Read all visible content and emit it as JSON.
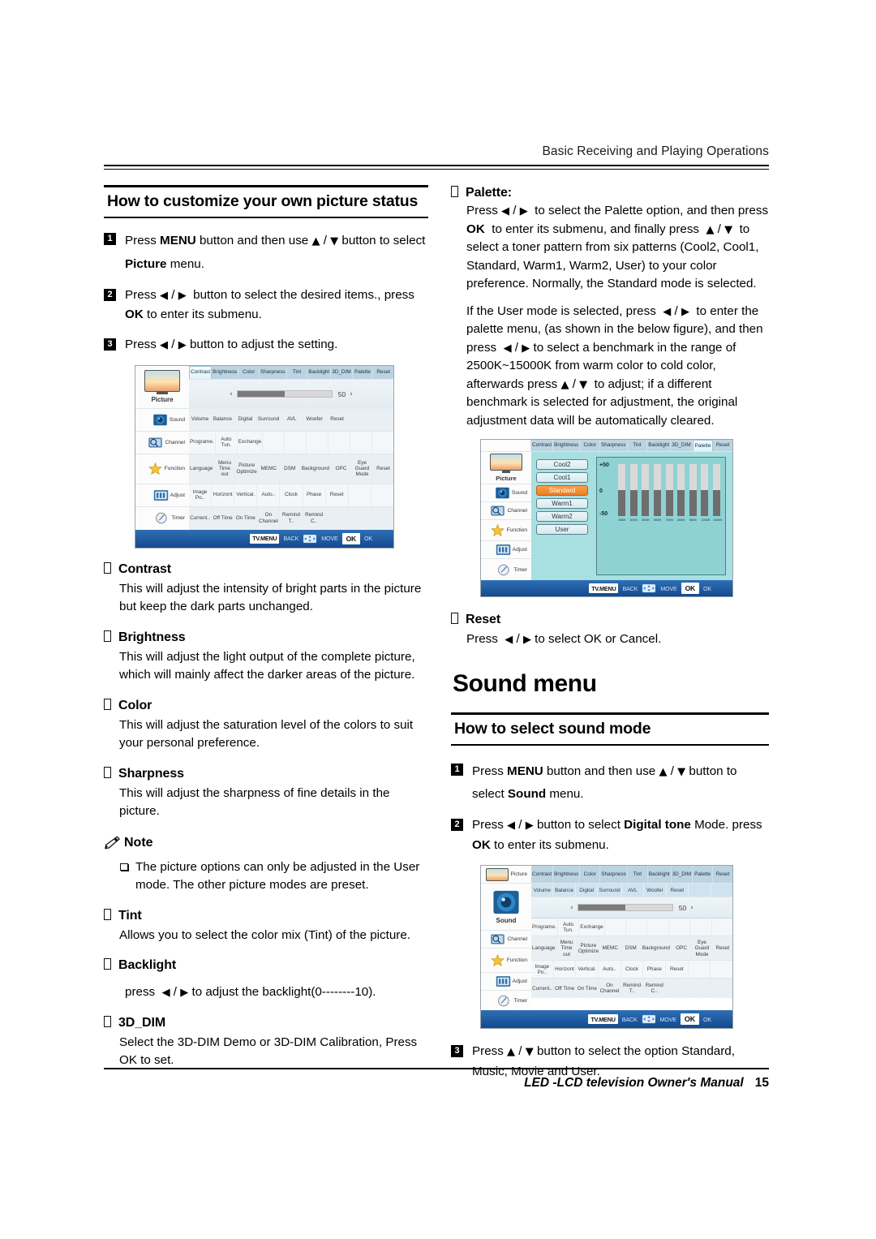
{
  "header": {
    "running_head": "Basic Receiving and Playing Operations"
  },
  "footer": {
    "manual_title": "LED -LCD television Owner's Manual",
    "page_number": "15"
  },
  "left_column": {
    "section_title": "How to customize your own picture status",
    "steps": [
      {
        "num": "1",
        "html": "Press <b>MENU</b> button and then use <span class=\"ar\">▲</span> / <span class=\"ar\">▼</span> button to select <b>Picture</b> menu."
      },
      {
        "num": "2",
        "html": "Press <span class=\"ar\">◀</span> / <span class=\"ar\">▶</span>&nbsp; button to select the desired items., press <b>OK</b> to enter its submenu."
      },
      {
        "num": "3",
        "html": "Press <span class=\"ar\">◀</span> / <span class=\"ar\">▶</span> button to adjust the setting."
      }
    ],
    "items": [
      {
        "title": "Contrast",
        "body": "This will adjust the intensity of bright parts in the picture but keep the dark parts unchanged."
      },
      {
        "title": "Brightness",
        "body": "This will adjust the light output of the complete picture, which will mainly affect the darker areas of the picture."
      },
      {
        "title": "Color",
        "body": "This will adjust the saturation level of the colors to suit your personal preference."
      },
      {
        "title": "Sharpness",
        "body": "This will adjust the sharpness of fine details in the picture."
      }
    ],
    "note": {
      "title": "Note",
      "text": "The picture options can only be adjusted in the User mode. The other picture modes are preset."
    },
    "items2": [
      {
        "title": "Tint",
        "body": "Allows you to select the color mix (Tint) of the picture."
      }
    ],
    "backlight": {
      "title": "Backlight",
      "body_html": "press&nbsp; <span class=\"ar\">◀</span> / <span class=\"ar\">▶</span> to adjust the backlight(0--------10)."
    },
    "dim": {
      "title": "3D_DIM",
      "body": "Select the 3D-DIM Demo or 3D-DIM Calibration, Press OK to set."
    }
  },
  "right_column": {
    "palette": {
      "title": "Palette:",
      "paragraph1_html": "Press <span class=\"ar\">◀</span> / <span class=\"ar\">▶</span>&nbsp; to select the Palette option, and then press <b>OK</b>&nbsp; to enter its submenu, and finally press&nbsp; <span class=\"ar\">▲</span> / <span class=\"ar\">▼</span>&nbsp; to select a toner pattern from six patterns (Cool2, Cool1, Standard, Warm1, Warm2, User) to your color preference. Normally, the Standard mode is selected.",
      "paragraph2_html": "If the User mode is selected, press&nbsp; <span class=\"ar\">◀</span> / <span class=\"ar\">▶</span>&nbsp; to enter the palette menu, (as shown in the below figure), and then press&nbsp; <span class=\"ar\">◀</span> / <span class=\"ar\">▶</span> to select a benchmark in the range of 2500K~15000K from warm color to cold color, afterwards press <span class=\"ar\">▲</span> / <span class=\"ar\">▼</span>&nbsp; to adjust; if a different benchmark is selected for adjustment, the original adjustment data will be automatically cleared."
    },
    "reset": {
      "title": "Reset",
      "body_html": "Press&nbsp; <span class=\"ar\">◀</span> / <span class=\"ar\">▶</span> to select OK or Cancel."
    },
    "chapter_title": "Sound menu",
    "section_title": "How to select sound mode",
    "steps": [
      {
        "num": "1",
        "html": "Press <b>MENU</b> button and then use <span class=\"ar\">▲</span> / <span class=\"ar\">▼</span> button to select <b>Sound</b> menu."
      },
      {
        "num": "2",
        "html": "Press <span class=\"ar\">◀</span> / <span class=\"ar\">▶</span> button to select <b>Digital tone</b> Mode. press <b>OK</b> to enter its submenu."
      },
      {
        "num": "3",
        "html": "Press <span class=\"ar\">▲</span> / <span class=\"ar\">▼</span> button to select the option Standard, Music, Movie and User."
      }
    ]
  },
  "osd": {
    "sidebar": [
      {
        "label": "Picture",
        "icon": "tv-icon"
      },
      {
        "label": "Sound",
        "icon": "speaker-icon"
      },
      {
        "label": "Channel",
        "icon": "channel-icon"
      },
      {
        "label": "Function",
        "icon": "star-icon"
      },
      {
        "label": "Adjust",
        "icon": "adjust-icon"
      },
      {
        "label": "Timer",
        "icon": "clock-icon"
      }
    ],
    "picture_row": [
      "Contrast",
      "Brightness",
      "Color",
      "Sharpness",
      "Tint",
      "Backlight",
      "3D_DIM",
      "Palette",
      "Reset"
    ],
    "sound_row": [
      "Volume",
      "Balance",
      "Digital",
      "Surround",
      "AVL",
      "Woofer",
      "Reset",
      "",
      ""
    ],
    "channel_row": [
      "Programe.",
      "Auto Tun.",
      "Exchange",
      "",
      "",
      "",
      "",
      "",
      ""
    ],
    "function_row": [
      "Language",
      "Menu Time out",
      "Picture Optimize",
      "MEMC",
      "DSM",
      "Background",
      "OPC",
      "Eye Guard Mode",
      "Reset"
    ],
    "adjust_row": [
      "Image Po..",
      "Horizont",
      "Vertical.",
      "Auto..",
      "Clock",
      "Phase",
      "Reset",
      "",
      ""
    ],
    "timer_row": [
      "Current..",
      "Off Time",
      "On Time",
      "On Channel",
      "Remind T..",
      "Remind C..",
      "",
      "",
      ""
    ],
    "slider": {
      "value": "50",
      "left_arrow": "‹",
      "right_arrow": "›",
      "fill_percent": 50
    },
    "bottom_bar": [
      {
        "key": "TV.MENU",
        "label": "BACK"
      },
      {
        "key": "dpad-icon",
        "label": "MOVE"
      },
      {
        "key": "OK",
        "label": "OK"
      }
    ],
    "figure1_selected_tab": "Contrast",
    "figure3_selected_tab": "Volume"
  },
  "palette_figure": {
    "selected_tab": "Palette",
    "presets": [
      "Cool2",
      "Cool1",
      "Standard",
      "Warm1",
      "Warm2",
      "User"
    ],
    "active_preset": "Standard",
    "chart_data": {
      "type": "bar",
      "title": "",
      "categories": [
        "2500K",
        "3000K",
        "5000K",
        "6500K",
        "7300K",
        "8500K",
        "9800K",
        "12000K",
        "15400K"
      ],
      "values": [
        0,
        0,
        0,
        0,
        0,
        0,
        0,
        0,
        0
      ],
      "ylabel": "",
      "xlabel": "",
      "ytick_labels": [
        "+50",
        "0",
        "-50"
      ],
      "ylim": [
        -50,
        50
      ],
      "grid": false,
      "legend": "none"
    }
  },
  "colors": {
    "osd_header_blue": "#bcd3e2",
    "osd_bottom_blue": "#14498f",
    "palette_bg": "#a8dfe0",
    "palette_chart_bg": "#8fd2d4",
    "palette_active_orange": "#ef7d23",
    "slider_fill": "#7b7b7b"
  }
}
